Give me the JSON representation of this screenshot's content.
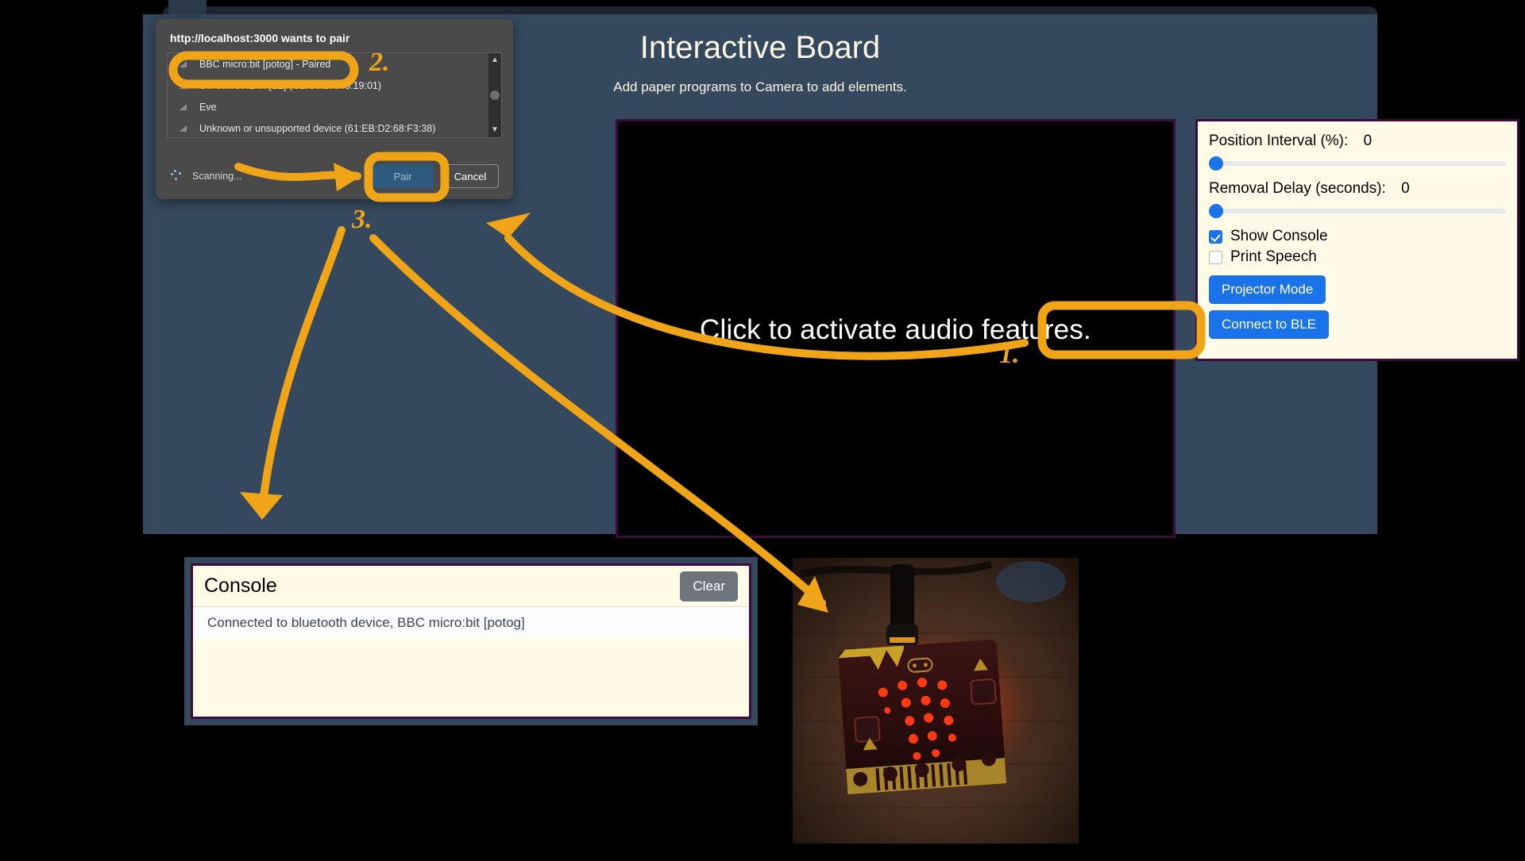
{
  "app": {
    "title": "Interactive Board",
    "subtitle": "Add paper programs to Camera to add elements.",
    "canvas_text": "Click to activate audio features."
  },
  "controls": {
    "position_interval_label": "Position Interval (%):",
    "position_interval_value": "0",
    "removal_delay_label": "Removal Delay (seconds):",
    "removal_delay_value": "0",
    "show_console_label": "Show Console",
    "show_console_checked": true,
    "print_speech_label": "Print Speech",
    "print_speech_checked": false,
    "projector_mode_label": "Projector Mode",
    "connect_ble_label": "Connect to BLE"
  },
  "console": {
    "title": "Console",
    "clear_label": "Clear",
    "lines": [
      "Connected to bluetooth device, BBC micro:bit [potog]"
    ]
  },
  "pair_dialog": {
    "title": "http://localhost:3000 wants to pair",
    "devices": [
      "BBC micro:bit [potog] - Paired",
      "STANMORE III [LE] (C1:C6:BA:48:19:01)",
      "Eve",
      "Unknown or unsupported device (61:EB:D2:68:F3:38)"
    ],
    "status": "Scanning...",
    "pair_label": "Pair",
    "cancel_label": "Cancel"
  },
  "annotations": {
    "steps": [
      "1.",
      "2.",
      "3."
    ],
    "color": "#f0a417"
  },
  "colors": {
    "app_background": "#34495e",
    "panel_background": "#fffbe6",
    "panel_border": "#3d0a3d",
    "accent_blue": "#1a73e8",
    "annotation_orange": "#f0a417"
  }
}
